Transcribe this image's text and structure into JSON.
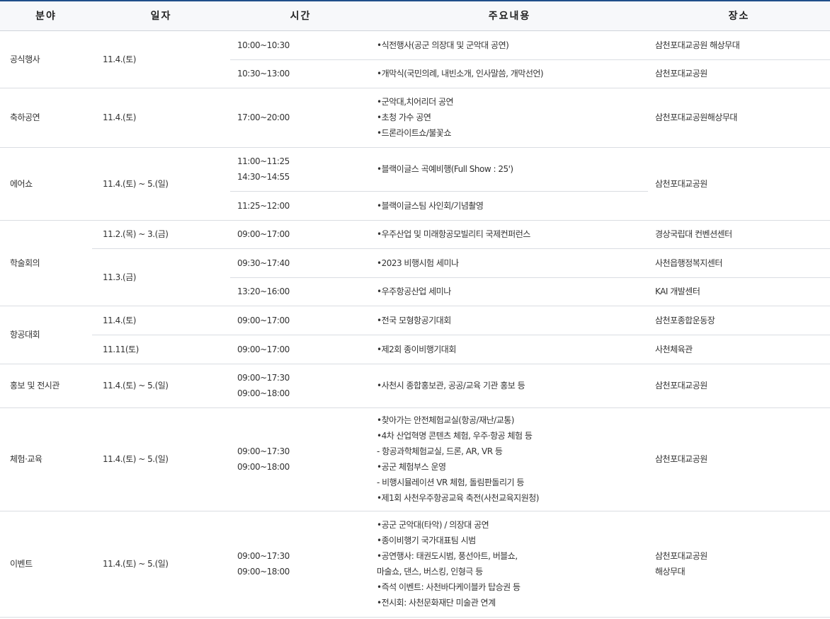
{
  "headers": {
    "field": "분야",
    "date": "일자",
    "time": "시간",
    "content": "주요내용",
    "place": "장소"
  },
  "rows": {
    "official": {
      "field": "공식행사",
      "date": "11.4.(토)",
      "r1": {
        "time": "10:00~10:30",
        "content": "•식전행사(공군 의장대 및 군악대 공연)",
        "place": "삼천포대교공원 해상무대"
      },
      "r2": {
        "time": "10:30~13:00",
        "content": "•개막식(국민의례, 내빈소개, 인사말씀, 개막선언)",
        "place": "삼천포대교공원"
      }
    },
    "celebration": {
      "field": "축하공연",
      "date": "11.4.(토)",
      "time": "17:00~20:00",
      "content": [
        "•군악대,치어리더 공연",
        "•초청 가수 공연",
        "•드론라이트쇼/불꽃쇼"
      ],
      "place": "삼천포대교공원해상무대"
    },
    "airshow": {
      "field": "에어쇼",
      "date": "11.4.(토) ~ 5.(일)",
      "place": "삼천포대교공원",
      "r1": {
        "time": [
          "11:00~11:25",
          "14:30~14:55"
        ],
        "content": "•블랙이글스 곡예비행(Full Show : 25')"
      },
      "r2": {
        "time": "11:25~12:00",
        "content": "•블랙이글스팀 사인회/기념촬영"
      }
    },
    "conference": {
      "field": "학술회의",
      "r1": {
        "date": "11.2.(목) ~ 3.(금)",
        "time": "09:00~17:00",
        "content": "•우주산업 및 미래항공모빌리티 국제컨퍼런스",
        "place": "경상국립대 컨벤션센터"
      },
      "date2": "11.3.(금)",
      "r2": {
        "time": "09:30~17:40",
        "content": "•2023 비행시험 세미나",
        "place": "사천읍행정복지센터"
      },
      "r3": {
        "time": "13:20~16:00",
        "content": "•우주항공산업 세미나",
        "place": "KAI 개발센터"
      }
    },
    "contest": {
      "field": "항공대회",
      "r1": {
        "date": "11.4.(토)",
        "time": "09:00~17:00",
        "content": "•전국 모형항공기대회",
        "place": "삼천포종합운동장"
      },
      "r2": {
        "date": "11.11(토)",
        "time": "09:00~17:00",
        "content": "•제2회 종이비행기대회",
        "place": "사천체육관"
      }
    },
    "pr": {
      "field": "홍보 및 전시관",
      "date": "11.4.(토) ~ 5.(일)",
      "time": [
        "09:00~17:30",
        "09:00~18:00"
      ],
      "content": "•사천시 종합홍보관, 공공/교육 기관 홍보 등",
      "place": "삼천포대교공원"
    },
    "experience": {
      "field": "체험·교육",
      "date": "11.4.(토) ~ 5.(일)",
      "time": [
        "09:00~17:30",
        "09:00~18:00"
      ],
      "content": [
        "•찾아가는 안전체험교실(항공/재난/교통)",
        "•4차 산업혁명 콘텐츠 체험, 우주·항공 체험 등",
        "- 항공과학체험교실, 드론, AR, VR 등",
        "•공군 체험부스 운영",
        "- 비행시뮬레이션 VR 체험, 돌림판돌리기 등",
        "•제1회 사천우주항공교육 축전(사천교육지원청)"
      ],
      "place": "삼천포대교공원"
    },
    "event": {
      "field": "이벤트",
      "date": "11.4.(토) ~ 5.(일)",
      "time": [
        "09:00~17:30",
        "09:00~18:00"
      ],
      "content": [
        "•공군 군악대(타악) / 의장대 공연",
        "•종이비행기 국가대표팀 시범",
        "•공연행사: 태권도시범, 풍선아트, 버블쇼,",
        "마술쇼, 댄스, 버스킹, 인형극 등",
        "•즉석 이벤트: 사천바다케이블카 탑승권 등",
        "•전시회: 사천문화재단 미술관 연계"
      ],
      "place": [
        "삼천포대교공원",
        "해상무대"
      ]
    }
  }
}
